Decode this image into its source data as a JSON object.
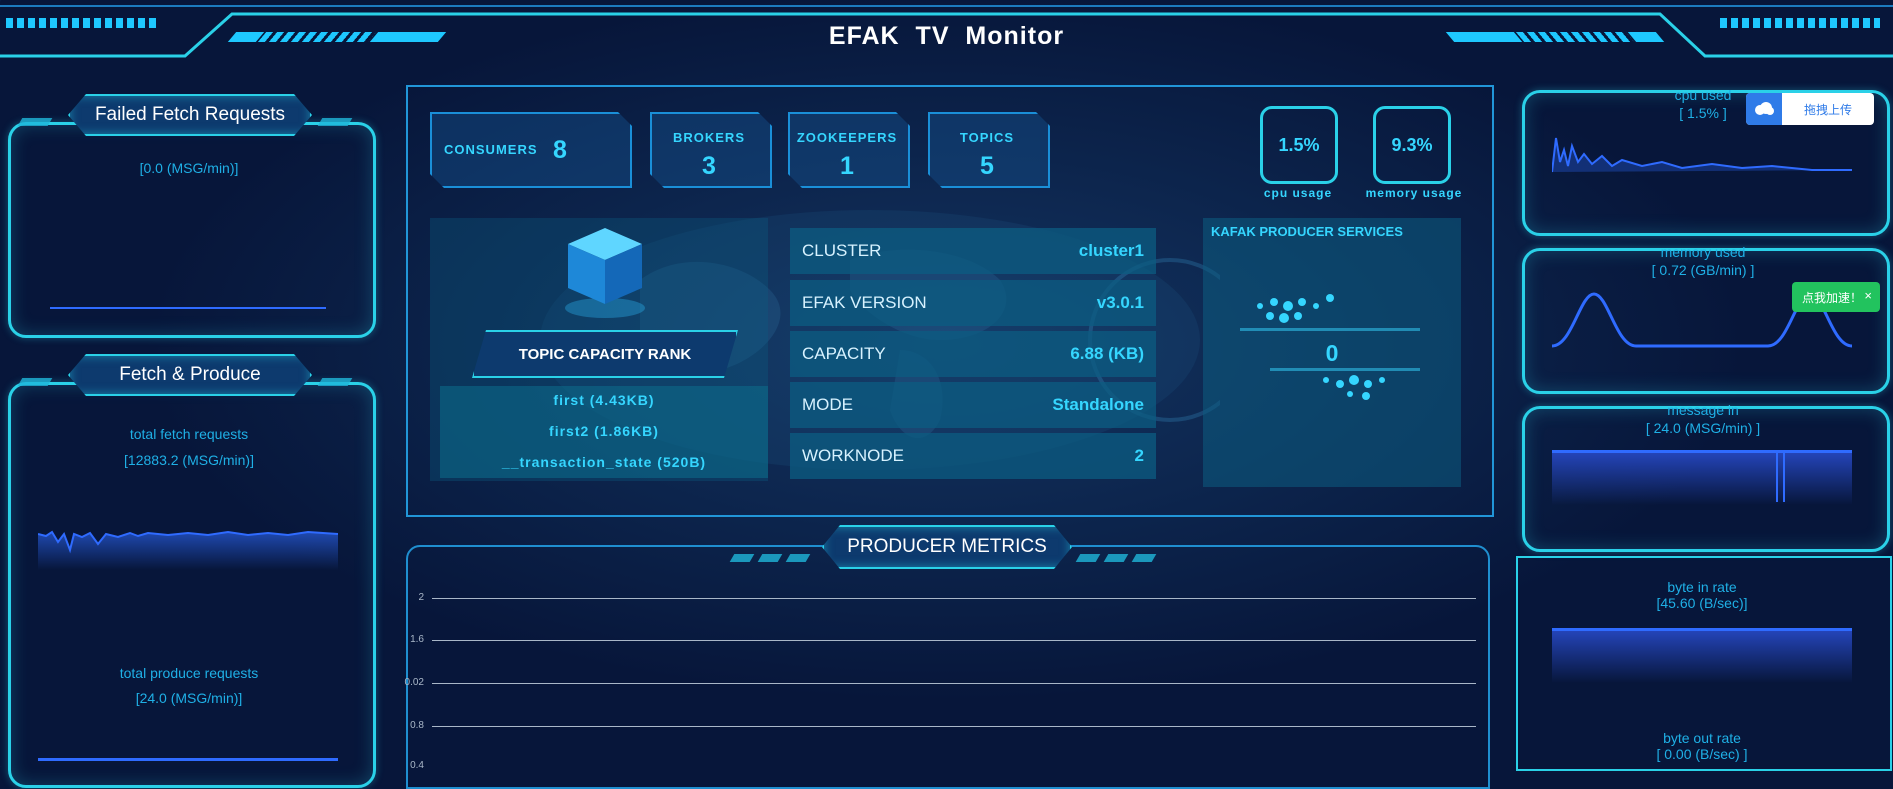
{
  "header": {
    "title": "EFAK  TV  Monitor"
  },
  "left": {
    "failed_title": "Failed Fetch Requests",
    "failed_value": "[0.0 (MSG/min)]",
    "fetch_title": "Fetch & Produce",
    "fetch_label": "total fetch requests",
    "fetch_value": "[12883.2 (MSG/min)]",
    "produce_label": "total produce requests",
    "produce_value": "[24.0 (MSG/min)]"
  },
  "stats": {
    "consumers_label": "CONSUMERS",
    "consumers_value": "8",
    "brokers_label": "BROKERS",
    "brokers_value": "3",
    "zookeepers_label": "ZOOKEEPERS",
    "zookeepers_value": "1",
    "topics_label": "TOPICS",
    "topics_value": "5",
    "cpu_value": "1.5%",
    "cpu_label": "cpu usage",
    "memory_value": "9.3%",
    "memory_label": "memory usage"
  },
  "rank": {
    "button": "TOPIC CAPACITY RANK",
    "items": [
      "first (4.43KB)",
      "first2 (1.86KB)",
      "__transaction_state (520B)"
    ]
  },
  "info": [
    {
      "key": "CLUSTER",
      "value": "cluster1"
    },
    {
      "key": "EFAK VERSION",
      "value": "v3.0.1"
    },
    {
      "key": "CAPACITY",
      "value": "6.88 (KB)"
    },
    {
      "key": "MODE",
      "value": "Standalone"
    },
    {
      "key": "WORKNODE",
      "value": "2"
    }
  ],
  "producer_services": {
    "title": "KAFAK PRODUCER SERVICES",
    "value": "0"
  },
  "metrics": {
    "title": "PRODUCER METRICS",
    "yticks": [
      "2",
      "1.6",
      "0.02",
      "0.8",
      "0.4"
    ]
  },
  "right": {
    "cpu_label": "cpu used",
    "cpu_value": "[ 1.5% ]",
    "mem_label": "memory used",
    "mem_value": "[ 0.72 (GB/min) ]",
    "msg_label": "message in",
    "msg_value": "[ 24.0 (MSG/min) ]",
    "bin_label": "byte in rate",
    "bin_value": "[45.60 (B/sec)]",
    "bout_label": "byte out rate",
    "bout_value": "[ 0.00 (B/sec) ]"
  },
  "overlays": {
    "upload_label": "拖拽上传",
    "toast_label": "点我加速！",
    "toast_close": "×"
  },
  "colors": {
    "accent": "#2ad1e8",
    "bg": "#07163a",
    "chart_blue": "#2f6bff"
  }
}
